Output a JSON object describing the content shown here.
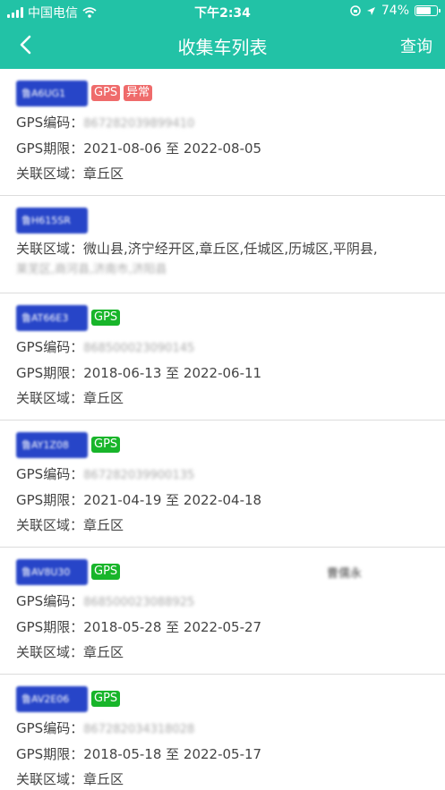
{
  "status_bar": {
    "carrier": "中国电信",
    "time": "下午2:34",
    "battery": "74%",
    "battery_level": 0.74
  },
  "nav": {
    "title": "收集车列表",
    "query_label": "查询"
  },
  "labels": {
    "gps_code": "GPS编码：",
    "gps_period": "GPS期限：",
    "area": "关联区域："
  },
  "cards": [
    {
      "plate": "鲁A6UG1",
      "badges": [
        "GPS",
        "异常"
      ],
      "gps_code": "867282039899410",
      "gps_period": "2021-08-06 至 2022-08-05",
      "area": "章丘区"
    },
    {
      "plate": "鲁H615SR",
      "area": "微山县,济宁经开区,章丘区,任城区,历城区,平阴县,",
      "area_extra": "莱芜区,商河县,济南市,济阳县"
    },
    {
      "plate": "鲁AT66E3",
      "badges": [
        "GPS"
      ],
      "gps_code": "868500023090145",
      "gps_period": "2018-06-13 至 2022-06-11",
      "area": "章丘区"
    },
    {
      "plate": "鲁AY1Z08",
      "badges": [
        "GPS"
      ],
      "gps_code": "867282039900135",
      "gps_period": "2021-04-19 至 2022-04-18",
      "area": "章丘区"
    },
    {
      "plate": "鲁AV8U30",
      "badges": [
        "GPS"
      ],
      "side_note": "曹儒永",
      "gps_code": "868500023088925",
      "gps_period": "2018-05-28 至 2022-05-27",
      "area": "章丘区"
    },
    {
      "plate": "鲁AV2E06",
      "badges": [
        "GPS"
      ],
      "gps_code": "867282034318028",
      "gps_period": "2018-05-18 至 2022-05-17",
      "area": "章丘区"
    }
  ]
}
